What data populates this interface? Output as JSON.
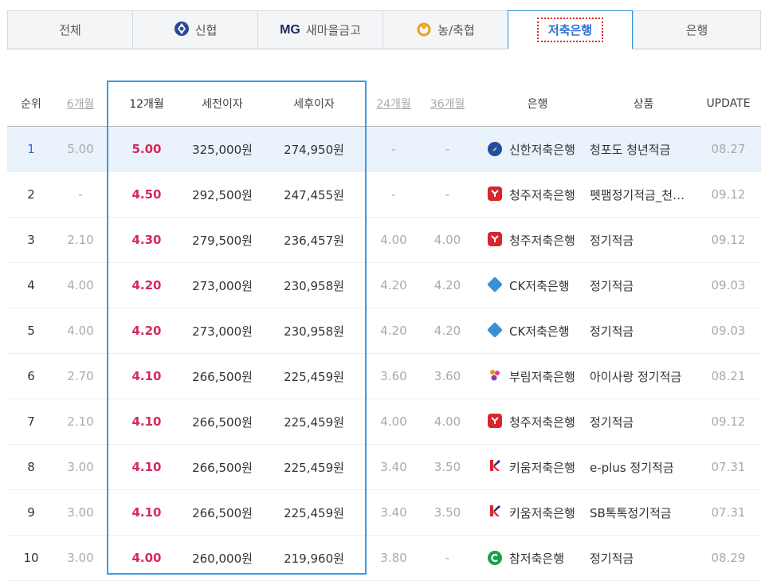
{
  "tabs": [
    {
      "label": "전체",
      "icon": ""
    },
    {
      "label": "신협",
      "icon": "shinhyup-logo-icon"
    },
    {
      "label": "새마을금고",
      "icon": "mg-logo-icon",
      "prefix": "MG"
    },
    {
      "label": "농/축협",
      "icon": "nonghyup-logo-icon"
    },
    {
      "label": "저축은행",
      "icon": "",
      "active": true
    },
    {
      "label": "은행",
      "icon": ""
    }
  ],
  "headers": {
    "rank": "순위",
    "m6": "6개월",
    "m12": "12개월",
    "pre_tax": "세전이자",
    "post_tax": "세후이자",
    "m24": "24개월",
    "m36": "36개월",
    "bank": "은행",
    "product": "상품",
    "update": "UPDATE"
  },
  "rows": [
    {
      "rank": "1",
      "m6": "5.00",
      "m12": "5.00",
      "pre_tax": "325,000원",
      "post_tax": "274,950원",
      "m24": "-",
      "m36": "-",
      "bank": "신한저축은행",
      "bank_icon": "shinhan-icon",
      "product": "청포도 청년적금",
      "update": "08.27"
    },
    {
      "rank": "2",
      "m6": "-",
      "m12": "4.50",
      "pre_tax": "292,500원",
      "post_tax": "247,455원",
      "m24": "-",
      "m36": "-",
      "bank": "청주저축은행",
      "bank_icon": "cheongju-icon",
      "product": "펫팸정기적금_천…",
      "update": "09.12"
    },
    {
      "rank": "3",
      "m6": "2.10",
      "m12": "4.30",
      "pre_tax": "279,500원",
      "post_tax": "236,457원",
      "m24": "4.00",
      "m36": "4.00",
      "bank": "청주저축은행",
      "bank_icon": "cheongju-icon",
      "product": "정기적금",
      "update": "09.12"
    },
    {
      "rank": "4",
      "m6": "4.00",
      "m12": "4.20",
      "pre_tax": "273,000원",
      "post_tax": "230,958원",
      "m24": "4.20",
      "m36": "4.20",
      "bank": "CK저축은행",
      "bank_icon": "ck-icon",
      "product": "정기적금",
      "update": "09.03"
    },
    {
      "rank": "5",
      "m6": "4.00",
      "m12": "4.20",
      "pre_tax": "273,000원",
      "post_tax": "230,958원",
      "m24": "4.20",
      "m36": "4.20",
      "bank": "CK저축은행",
      "bank_icon": "ck-icon",
      "product": "정기적금",
      "update": "09.03"
    },
    {
      "rank": "6",
      "m6": "2.70",
      "m12": "4.10",
      "pre_tax": "266,500원",
      "post_tax": "225,459원",
      "m24": "3.60",
      "m36": "3.60",
      "bank": "부림저축은행",
      "bank_icon": "burim-icon",
      "product": "아이사랑 정기적금",
      "update": "08.21"
    },
    {
      "rank": "7",
      "m6": "2.10",
      "m12": "4.10",
      "pre_tax": "266,500원",
      "post_tax": "225,459원",
      "m24": "4.00",
      "m36": "4.00",
      "bank": "청주저축은행",
      "bank_icon": "cheongju-icon",
      "product": "정기적금",
      "update": "09.12"
    },
    {
      "rank": "8",
      "m6": "3.00",
      "m12": "4.10",
      "pre_tax": "266,500원",
      "post_tax": "225,459원",
      "m24": "3.40",
      "m36": "3.50",
      "bank": "키움저축은행",
      "bank_icon": "kiwoom-icon",
      "product": "e-plus 정기적금",
      "update": "07.31"
    },
    {
      "rank": "9",
      "m6": "3.00",
      "m12": "4.10",
      "pre_tax": "266,500원",
      "post_tax": "225,459원",
      "m24": "3.40",
      "m36": "3.50",
      "bank": "키움저축은행",
      "bank_icon": "kiwoom-icon",
      "product": "SB톡톡정기적금",
      "update": "07.31"
    },
    {
      "rank": "10",
      "m6": "3.00",
      "m12": "4.00",
      "pre_tax": "260,000원",
      "post_tax": "219,960원",
      "m24": "3.80",
      "m36": "-",
      "bank": "참저축은행",
      "bank_icon": "cham-icon",
      "product": "정기적금",
      "update": "08.29"
    }
  ],
  "colors": {
    "accent_blue": "#2e8fd6",
    "rate_red": "#d42a5a",
    "highlight_row": "#eaf2fb",
    "active_tab_marker": "#e02020"
  }
}
